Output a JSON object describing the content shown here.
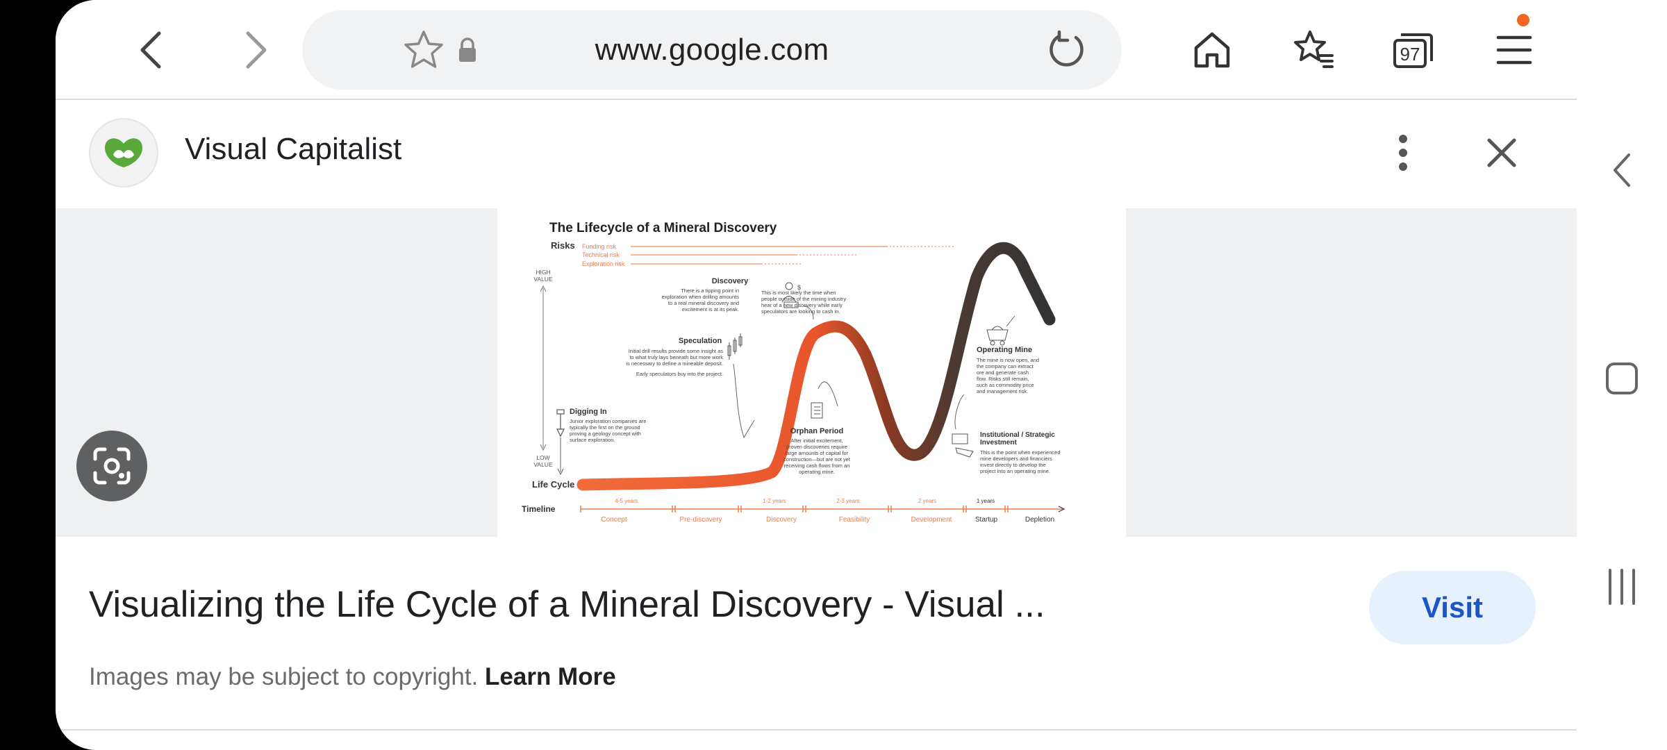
{
  "browser": {
    "url": "www.google.com",
    "tab_count": "97",
    "notification_color": "#f26522"
  },
  "source": {
    "name": "Visual Capitalist",
    "logo_color": "#5aa83a"
  },
  "infographic": {
    "title": "The Lifecycle of a Mineral Discovery",
    "risks_label": "Risks",
    "risks": [
      "Funding risk",
      "Technical risk",
      "Exploration risk"
    ],
    "high_value": [
      "HIGH",
      "VALUE"
    ],
    "low_value": [
      "LOW",
      "VALUE"
    ],
    "life_cycle_label": "Life Cycle",
    "timeline_label": "Timeline",
    "stages": [
      {
        "name": "Discovery",
        "text": [
          "There is a tipping point in",
          "exploration when drilling amounts",
          "to a real mineral discovery and",
          "excitement is at its peak."
        ]
      },
      {
        "name": "Speculation",
        "text": [
          "Initial drill results provide some insight as",
          "to what truly lays beneath but more work",
          "is necessary to define a mineable deposit.",
          "Early speculators buy into the project."
        ]
      },
      {
        "name": "Digging In",
        "text": [
          "Junior exploration companies are",
          "typically the first on the ground",
          "proving a geology concept with",
          "surface exploration."
        ]
      },
      {
        "name": "Orphan Period",
        "text": [
          "After initial excitement,",
          "proven discoveries require",
          "large amounts of capital for",
          "construction—but are not yet",
          "receiving cash flows from an",
          "operating mine."
        ]
      },
      {
        "name": "Operating Mine",
        "text": [
          "The mine is now open, and",
          "the company can extract",
          "ore and generate cash",
          "flow. Risks still remain,",
          "such as commodity price",
          "and management risk."
        ]
      },
      {
        "name": "Institutional / Strategic",
        "name2": "Investment",
        "text": [
          "This is the point when experienced",
          "mine developers and financiers",
          "invest directly to develop the",
          "project into an operating mine."
        ]
      }
    ],
    "speculator_note": [
      "This is most likely the time when",
      "people outside of the mining industry",
      "hear of a new discovery while early",
      "speculators are looking to cash in."
    ],
    "timeline": {
      "durations": [
        "4-5 years",
        "1-2 years",
        "2-3 years",
        "2 years",
        "1 years"
      ],
      "phases": [
        "Concept",
        "Pre-discovery",
        "Discovery",
        "Feasibility",
        "Development",
        "Startup",
        "Depletion"
      ]
    }
  },
  "result": {
    "title": "Visualizing the Life Cycle of a Mineral Discovery - Visual ...",
    "visit_label": "Visit",
    "copyright_text": "Images may be subject to copyright.",
    "learn_more_label": "Learn More"
  }
}
